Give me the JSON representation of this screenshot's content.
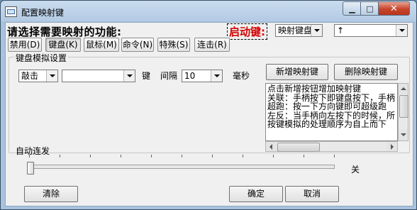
{
  "window": {
    "title": "配置映射键"
  },
  "header": {
    "prompt": "请选择需要映射的功能:",
    "start_label": "启动键:",
    "mapping_type": "映射键盘",
    "key_value": "↑"
  },
  "tabs": [
    {
      "label": "禁用(D)",
      "selected": false
    },
    {
      "label": "键盘(K)",
      "selected": true
    },
    {
      "label": "鼠标(M)",
      "selected": false
    },
    {
      "label": "命令(N)",
      "selected": false
    },
    {
      "label": "特殊(S)",
      "selected": false
    },
    {
      "label": "连击(R)",
      "selected": false
    }
  ],
  "keyboard_group": {
    "title": "键盘模拟设置",
    "action": "敲击",
    "key": "",
    "key_label": "键",
    "interval_label": "间隔",
    "interval_value": "10",
    "unit_label": "毫秒",
    "add_button": "新增映射键",
    "delete_button": "删除映射键",
    "description": [
      "点击新增按钮增加映射键",
      "关联：手柄按下即键盘按下，手柄",
      "超跑：按一下方向键即可超级跑",
      "左反：当手柄向左按下的时候，所",
      "按键模拟的处理顺序为自上而下"
    ]
  },
  "auto_fire": {
    "label": "自动连发",
    "state": "关",
    "level": 0
  },
  "footer": {
    "clear": "清除",
    "ok": "确定",
    "cancel": "取消"
  }
}
